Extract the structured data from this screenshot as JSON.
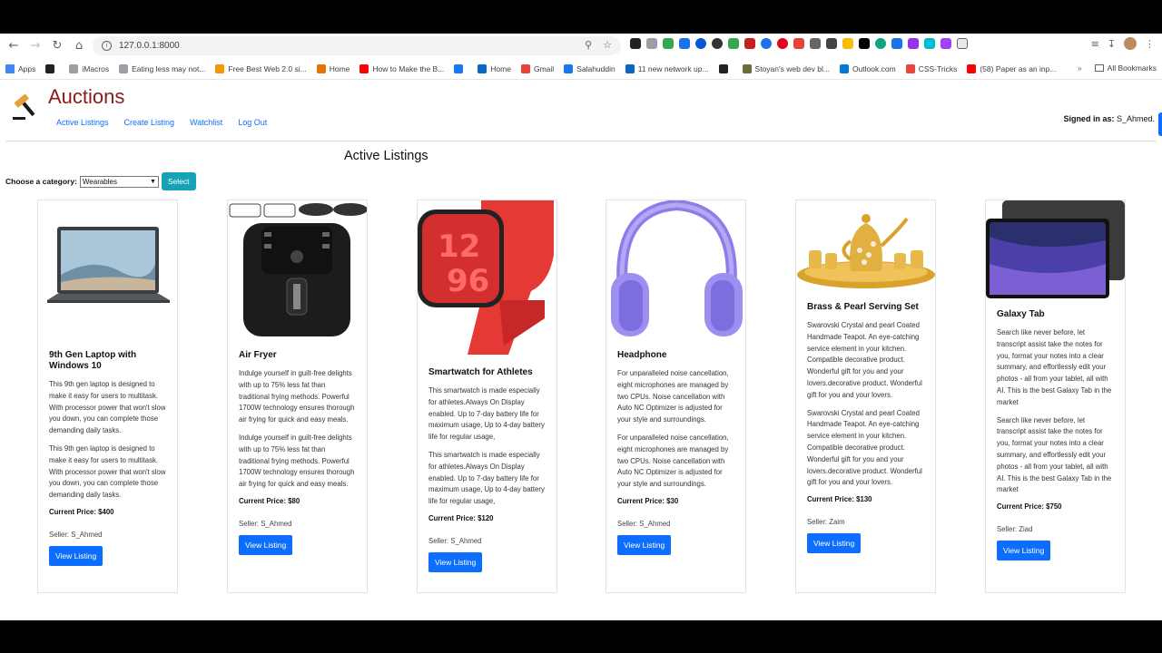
{
  "browser": {
    "url": "127.0.0.1:8000",
    "bookmarks": [
      {
        "label": "Apps",
        "color": "#4285f4"
      },
      {
        "label": "",
        "color": "#222222"
      },
      {
        "label": "iMacros",
        "color": "#9aa0a6"
      },
      {
        "label": "Eating less may not...",
        "color": "#9aa0a6"
      },
      {
        "label": "Free Best Web 2.0 si...",
        "color": "#f29900"
      },
      {
        "label": "Home",
        "color": "#e37400"
      },
      {
        "label": "How to Make the B...",
        "color": "#ff0000"
      },
      {
        "label": "",
        "color": "#1877f2"
      },
      {
        "label": "Home",
        "color": "#0a66c2"
      },
      {
        "label": "Gmail",
        "color": "#ea4335"
      },
      {
        "label": "Salahuddin",
        "color": "#1877f2"
      },
      {
        "label": "11 new network up...",
        "color": "#0a66c2"
      },
      {
        "label": "",
        "color": "#222222"
      },
      {
        "label": "Stoyan's web dev bl...",
        "color": "#6b6b3a"
      },
      {
        "label": "Outlook.com",
        "color": "#0078d4"
      },
      {
        "label": "CSS-Tricks",
        "color": "#e8453c"
      },
      {
        "label": "(58) Paper as an inp...",
        "color": "#ff0000"
      }
    ],
    "all_bookmarks": "All Bookmarks"
  },
  "site": {
    "brand": "Auctions",
    "nav": [
      "Active Listings",
      "Create Listing",
      "Watchlist",
      "Log Out"
    ],
    "signed_in_label": "Signed in as:",
    "signed_in_user": "S_Ahmed.",
    "heading": "Active Listings",
    "category_label": "Choose a category:",
    "category_value": "Wearables",
    "select_button": "Select"
  },
  "listings": [
    {
      "title": "9th Gen Laptop with Windows 10",
      "desc": [
        "This 9th gen laptop is designed to make it easy for users to multitask. With processor power that won't slow you down, you can complete those demanding daily tasks.",
        "This 9th gen laptop is designed to make it easy for users to multitask. With processor power that won't slow you down, you can complete those demanding daily tasks."
      ],
      "price": "Current Price: $400",
      "seller": "Seller: S_Ahmed",
      "button": "View Listing",
      "image": "laptop-image"
    },
    {
      "title": "Air Fryer",
      "desc": [
        "Indulge yourself in guilt-free delights with up to 75% less fat than traditional frying methods. Powerful 1700W technology ensures thorough air frying for quick and easy meals.",
        "Indulge yourself in guilt-free delights with up to 75% less fat than traditional frying methods. Powerful 1700W technology ensures thorough air frying for quick and easy meals."
      ],
      "price": "Current Price: $80",
      "seller": "Seller: S_Ahmed",
      "button": "View Listing",
      "image": "air-fryer-image"
    },
    {
      "title": "Smartwatch for Athletes",
      "desc": [
        "This smartwatch is made especially for athletes.Always On Display enabled. Up to 7-day battery life for maximum usage, Up to 4-day battery life for regular usage,",
        "This smartwatch is made especially for athletes.Always On Display enabled. Up to 7-day battery life for maximum usage, Up to 4-day battery life for regular usage,"
      ],
      "price": "Current Price: $120",
      "seller": "Seller: S_Ahmed",
      "button": "View Listing",
      "image": "smartwatch-image"
    },
    {
      "title": "Headphone",
      "desc": [
        "For unparalleled noise cancellation, eight microphones are managed by two CPUs. Noise cancellation with Auto NC Optimizer is adjusted for your style and surroundings.",
        "For unparalleled noise cancellation, eight microphones are managed by two CPUs. Noise cancellation with Auto NC Optimizer is adjusted for your style and surroundings."
      ],
      "price": "Current Price: $30",
      "seller": "Seller: S_Ahmed",
      "button": "View Listing",
      "image": "headphone-image"
    },
    {
      "title": "Brass & Pearl Serving Set",
      "desc": [
        "Swarovski Crystal and pearl Coated Handmade Teapot. An eye-catching service element in your kitchen. Compatible decorative product. Wonderful gift for you and your lovers.decorative product. Wonderful gift for you and your lovers.",
        "Swarovski Crystal and pearl Coated Handmade Teapot. An eye-catching service element in your kitchen. Compatible decorative product. Wonderful gift for you and your lovers.decorative product. Wonderful gift for you and your lovers."
      ],
      "price": "Current Price: $130",
      "seller": "Seller: Zaim",
      "button": "View Listing",
      "image": "teapot-set-image"
    },
    {
      "title": "Galaxy Tab",
      "desc": [
        "Search like never before, let transcript assist take the notes for you, format your notes into a clear summary, and effortlessly edit your photos - all from your tablet, all with AI. This is the best Galaxy Tab in the market",
        "Search like never before, let transcript assist take the notes for you, format your notes into a clear summary, and effortlessly edit your photos - all from your tablet, all with AI. This is the best Galaxy Tab in the market"
      ],
      "price": "Current Price: $750",
      "seller": "Seller: Ziad",
      "button": "View Listing",
      "image": "tablet-image"
    }
  ]
}
